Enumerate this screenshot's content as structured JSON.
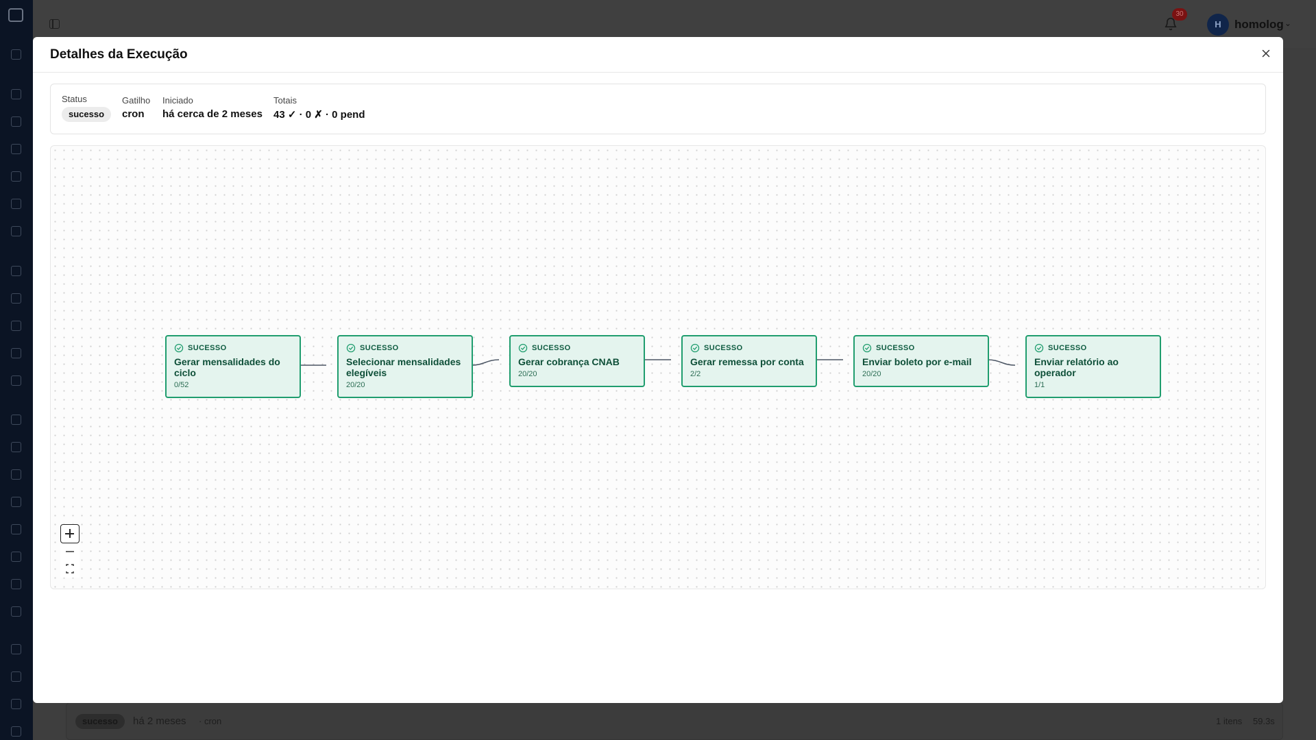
{
  "user": {
    "avatar_initial": "H",
    "name": "homolog",
    "notifications": "30"
  },
  "background_row": {
    "status": "sucesso",
    "started": "há 2 meses",
    "trigger": "· cron",
    "items": "1 itens",
    "duration": "59.3s"
  },
  "modal": {
    "title": "Detalhes da Execução",
    "summary": {
      "status_label": "Status",
      "status_value": "sucesso",
      "trigger_label": "Gatilho",
      "trigger_value": "cron",
      "started_label": "Iniciado",
      "started_value": "há cerca de 2 meses",
      "totals_label": "Totais",
      "totals_value": "43 ✓ · 0 ✗ · 0 pend"
    },
    "nodes": [
      {
        "status": "SUCESSO",
        "title": "Gerar mensalidades do ciclo",
        "count": "0/52"
      },
      {
        "status": "SUCESSO",
        "title": "Selecionar mensalidades elegíveis",
        "count": "20/20"
      },
      {
        "status": "SUCESSO",
        "title": "Gerar cobrança CNAB",
        "count": "20/20"
      },
      {
        "status": "SUCESSO",
        "title": "Gerar remessa por conta",
        "count": "2/2"
      },
      {
        "status": "SUCESSO",
        "title": "Enviar boleto por e-mail",
        "count": "20/20"
      },
      {
        "status": "SUCESSO",
        "title": "Enviar relatório ao operador",
        "count": "1/1"
      }
    ]
  },
  "colors": {
    "node_border": "#1f9d6e",
    "node_fill": "#e4f4ee",
    "overlay": "#3e3e3e"
  },
  "icons": {
    "close": "close-icon",
    "node_status": "check-circle-icon",
    "bell": "bell-icon"
  }
}
